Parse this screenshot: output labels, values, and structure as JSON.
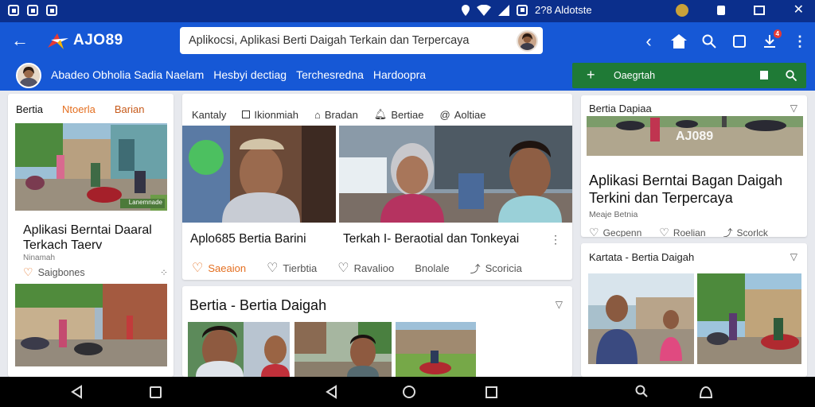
{
  "status_bar": {
    "info_text": "2?8 Aldotste",
    "icons": [
      "notification-icon",
      "notification-icon",
      "notification-icon",
      "location-icon",
      "wifi-icon",
      "signal-icon",
      "photo-icon",
      "face-icon",
      "security-icon",
      "square-icon",
      "close-icon"
    ]
  },
  "app_bar": {
    "logo_text": "AJO89",
    "search_text": "Aplikocsi, Aplikasi Berti Daigah Terkain dan Terpercaya",
    "notification_badge": "4"
  },
  "sub_bar": {
    "nav_items": [
      "Abadeo Obholia Sadia Naelam",
      "Hesbyi dectiag",
      "Terchesredna",
      "Hardoopra"
    ],
    "search_label": "Oaegrtah"
  },
  "left_card": {
    "tabs": [
      "Bertia",
      "Ntoerla",
      "Barian"
    ],
    "photo_label": "Lanemnade",
    "title": "Aplikasi Berntai Daaral Terkach Taerv",
    "source": "Ninamah",
    "action": "Saigbones"
  },
  "middle_card": {
    "tabs": [
      "Kantaly",
      "Ikionmiah",
      "Bradan",
      "Bertiae",
      "Aoltiae"
    ],
    "articles": [
      {
        "title": "Aplo685 Bertia Barini",
        "actions": [
          "Saeaion",
          "Tierbtia"
        ]
      },
      {
        "title": "Terkah I- Beraotial dan Tonkeyai",
        "actions": [
          "Ravalioo",
          "Bnolale",
          "Scoricia"
        ]
      }
    ]
  },
  "section2": {
    "title": "Bertia - Bertia Daigah"
  },
  "right_card1": {
    "header": "Bertia Dapiaa",
    "watermark": "AJ089",
    "title": "Aplikasi Berntai Bagan Daigah Terkini dan Terpercaya",
    "subtitle": "Meaje Betnia",
    "actions": [
      "Gecpenn",
      "Roelian",
      "Scorlck"
    ]
  },
  "right_card2": {
    "header": "Kartata - Bertia Daigah"
  },
  "colors": {
    "status_bar": "#0b2f8c",
    "app_bar": "#1658d6",
    "accent_orange": "#e46f20",
    "green_search": "#1f7a36"
  }
}
